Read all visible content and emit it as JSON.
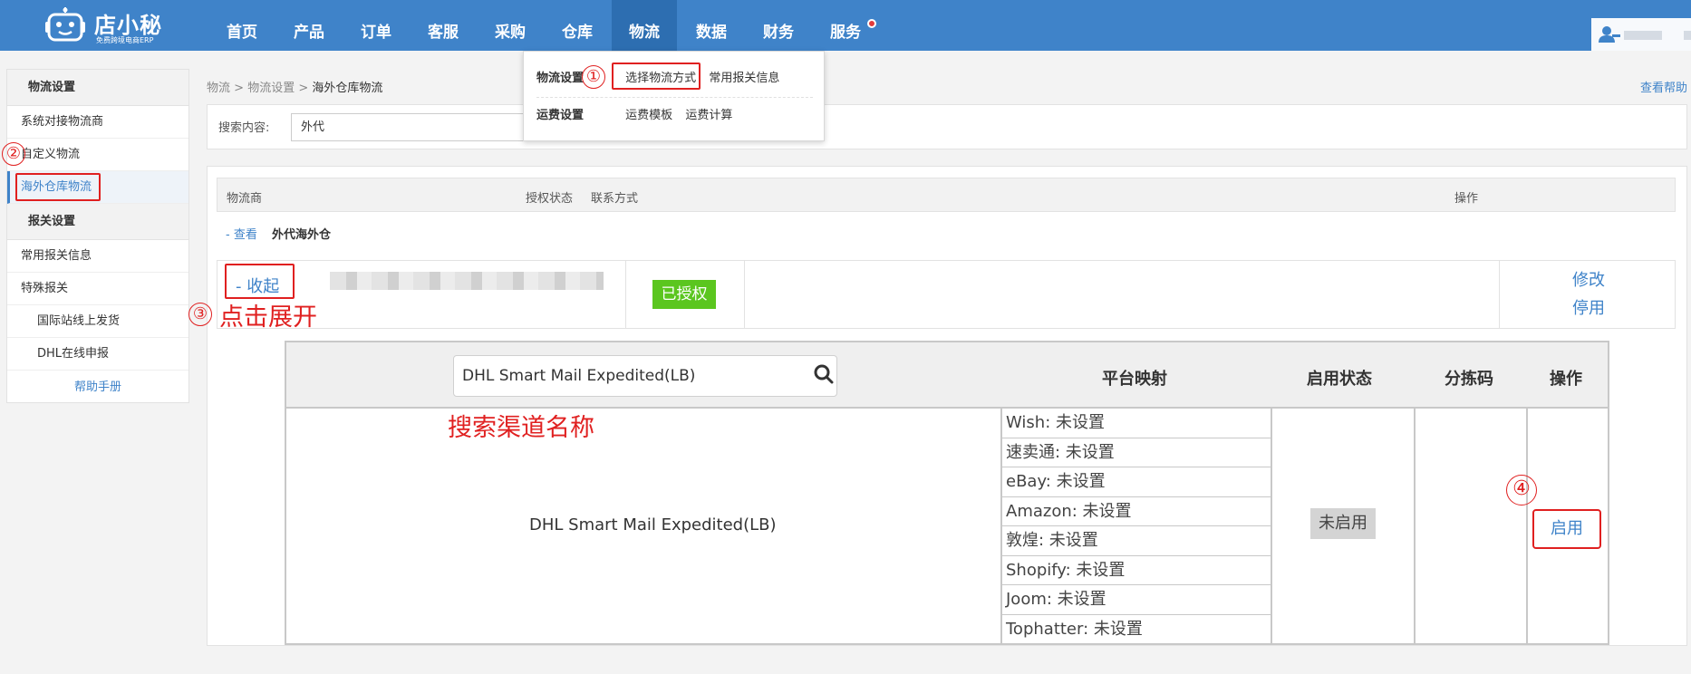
{
  "app": {
    "logo_name": "店小秘",
    "logo_subtitle": "免费跨境电商ERP"
  },
  "nav": {
    "items": [
      {
        "label": "首页"
      },
      {
        "label": "产品"
      },
      {
        "label": "订单"
      },
      {
        "label": "客服"
      },
      {
        "label": "采购"
      },
      {
        "label": "仓库"
      },
      {
        "label": "物流"
      },
      {
        "label": "数据"
      },
      {
        "label": "财务"
      },
      {
        "label": "服务"
      }
    ],
    "active": "物流"
  },
  "dropdown": {
    "group1": "物流设置",
    "group1_links": [
      "选择物流方式",
      "常用报关信息"
    ],
    "group2": "运费设置",
    "group2_links": [
      "运费模板",
      "运费计算"
    ]
  },
  "sidebar": {
    "section1": "物流设置",
    "items1": [
      "系统对接物流商",
      "自定义物流",
      "海外仓库物流"
    ],
    "section2": "报关设置",
    "items2": [
      "常用报关信息",
      "特殊报关",
      "国际站线上发货",
      "DHL在线申报"
    ],
    "help": "帮助手册"
  },
  "breadcrumb": {
    "part1": "物流",
    "sep": " > ",
    "part2": "物流设置",
    "current": "海外仓库物流"
  },
  "help_link": "查看帮助",
  "search": {
    "label": "搜索内容:",
    "value": "外代"
  },
  "table": {
    "headers": [
      "物流商",
      "授权状态",
      "联系方式",
      "操作"
    ],
    "group_view": "- 查看",
    "group_name": "外代海外仓",
    "collapse": "- 收起",
    "auth_status": "已授权",
    "ops": [
      "修改",
      "停用"
    ]
  },
  "channel_table": {
    "search_value": "DHL Smart Mail Expedited(LB)",
    "headers": [
      "平台映射",
      "启用状态",
      "分拣码",
      "操作"
    ],
    "channel_name": "DHL Smart Mail Expedited(LB)",
    "platforms": [
      "Wish: 未设置",
      "速卖通: 未设置",
      "eBay: 未设置",
      "Amazon: 未设置",
      "敦煌: 未设置",
      "Shopify: 未设置",
      "Joom: 未设置",
      "Tophatter: 未设置"
    ],
    "status": "未启用",
    "enable_button": "启用"
  },
  "annotations": {
    "step1": "①",
    "step2": "②",
    "step3": "③",
    "step3_text": "点击展开",
    "step4": "④",
    "search_hint": "搜索渠道名称"
  },
  "colors": {
    "nav_bg": "#3f83c9",
    "nav_active": "#2d6eb1",
    "link": "#3f83c9",
    "annotation_red": "#e02020",
    "authorized_green": "#5bc61f"
  }
}
